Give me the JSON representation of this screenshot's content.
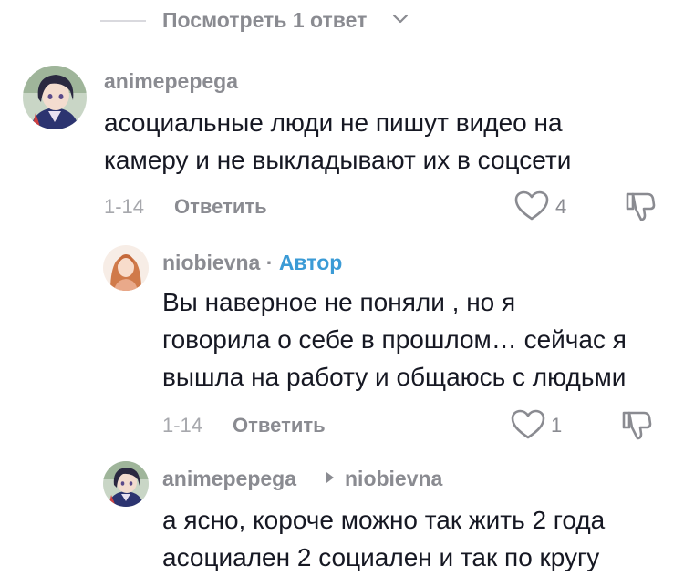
{
  "view_replies": {
    "label": "Посмотреть 1 ответ"
  },
  "comments": [
    {
      "username": "animepepega",
      "text_lines": [
        "асоциальные люди не пишут видео на",
        "камеру и не выкладывают их в соцсети"
      ],
      "date": "1-14",
      "reply_label": "Ответить",
      "likes": "4"
    },
    {
      "username": "niobievna",
      "separator": "·",
      "author_tag": "Автор",
      "text_lines": [
        "Вы наверное не поняли , но я",
        "говорила о себе в прошлом… сейчас я",
        "вышла на работу и общаюсь с людьми"
      ],
      "date": "1-14",
      "reply_label": "Ответить",
      "likes": "1"
    },
    {
      "username": "animepepega",
      "reply_to": "niobievna",
      "text_lines": [
        "а ясно, короче можно так жить 2 года",
        "асоциален 2 социален и так по кругу"
      ]
    }
  ],
  "colors": {
    "text": "#161823",
    "muted": "#8a8b91",
    "author": "#3b9bd6"
  }
}
